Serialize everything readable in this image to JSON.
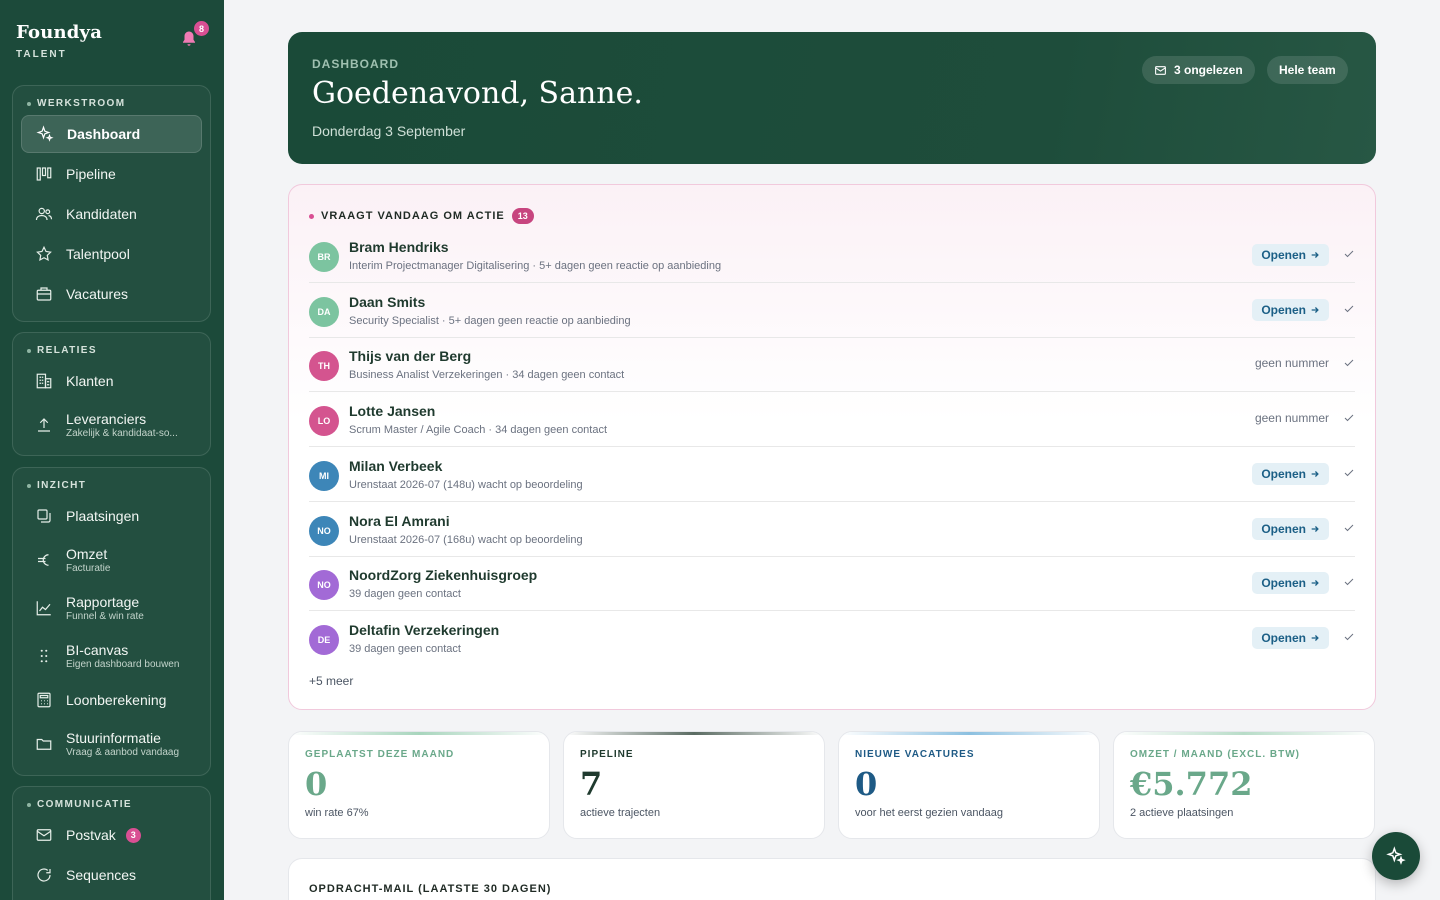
{
  "brand": {
    "name": "Foundya",
    "sub": "TALENT",
    "notifications": "8"
  },
  "nav": {
    "werkstroom": {
      "title": "WERKSTROOM",
      "items": [
        {
          "label": "Dashboard",
          "icon": "sparkle-icon"
        },
        {
          "label": "Pipeline",
          "icon": "kanban-icon"
        },
        {
          "label": "Kandidaten",
          "icon": "users-icon"
        },
        {
          "label": "Talentpool",
          "icon": "star-icon"
        },
        {
          "label": "Vacatures",
          "icon": "briefcase-icon"
        }
      ]
    },
    "relaties": {
      "title": "RELATIES",
      "items": [
        {
          "label": "Klanten",
          "icon": "building-icon"
        },
        {
          "label": "Leveranciers",
          "sub": "Zakelijk & kandidaat-so...",
          "icon": "upload-icon"
        }
      ]
    },
    "inzicht": {
      "title": "INZICHT",
      "items": [
        {
          "label": "Plaatsingen",
          "icon": "copy-icon"
        },
        {
          "label": "Omzet",
          "sub": "Facturatie",
          "icon": "euro-icon"
        },
        {
          "label": "Rapportage",
          "sub": "Funnel & win rate",
          "icon": "chart-icon"
        },
        {
          "label": "BI-canvas",
          "sub": "Eigen dashboard bouwen",
          "icon": "grid-dots-icon"
        },
        {
          "label": "Loonberekening",
          "icon": "calculator-icon"
        },
        {
          "label": "Stuurinformatie",
          "sub": "Vraag & aanbod vandaag",
          "icon": "folder-icon"
        }
      ]
    },
    "communicatie": {
      "title": "COMMUNICATIE",
      "items": [
        {
          "label": "Postvak",
          "badge": "3",
          "icon": "mail-icon"
        },
        {
          "label": "Sequences",
          "icon": "refresh-icon"
        }
      ]
    }
  },
  "header": {
    "eyebrow": "DASHBOARD",
    "title": "Goedenavond, Sanne.",
    "date": "Donderdag 3 September",
    "unread": "3 ongelezen",
    "team": "Hele team"
  },
  "action": {
    "title": "VRAAGT VANDAAG OM ACTIE",
    "count": "13",
    "open_label": "Openen",
    "no_number_label": "geen nummer",
    "more": "+5 meer",
    "rows": [
      {
        "initials": "BR",
        "name": "Bram Hendriks",
        "sub": "Interim Projectmanager Digitalisering · 5+ dagen geen reactie op aanbieding",
        "action": "open",
        "color": "#7cc4a0"
      },
      {
        "initials": "DA",
        "name": "Daan Smits",
        "sub": "Security Specialist · 5+ dagen geen reactie op aanbieding",
        "action": "open",
        "color": "#7cc4a0"
      },
      {
        "initials": "TH",
        "name": "Thijs van der Berg",
        "sub": "Business Analist Verzekeringen · 34 dagen geen contact",
        "action": "none",
        "color": "#d4548f"
      },
      {
        "initials": "LO",
        "name": "Lotte Jansen",
        "sub": "Scrum Master / Agile Coach · 34 dagen geen contact",
        "action": "none",
        "color": "#d4548f"
      },
      {
        "initials": "MI",
        "name": "Milan Verbeek",
        "sub": "Urenstaat 2026-07 (148u) wacht op beoordeling",
        "action": "open",
        "color": "#3d86b8"
      },
      {
        "initials": "NO",
        "name": "Nora El Amrani",
        "sub": "Urenstaat 2026-07 (168u) wacht op beoordeling",
        "action": "open",
        "color": "#3d86b8"
      },
      {
        "initials": "NO",
        "name": "NoordZorg Ziekenhuisgroep",
        "sub": "39 dagen geen contact",
        "action": "open",
        "color": "#a26ad6"
      },
      {
        "initials": "DE",
        "name": "Deltafin Verzekeringen",
        "sub": "39 dagen geen contact",
        "action": "open",
        "color": "#a26ad6"
      }
    ]
  },
  "kpis": [
    {
      "label": "GEPLAATST DEZE MAAND",
      "value": "0",
      "sub": "win rate 67%",
      "color": "#6aa88a"
    },
    {
      "label": "PIPELINE",
      "value": "7",
      "sub": "actieve trajecten",
      "color": "#1f3a2e"
    },
    {
      "label": "NIEUWE VACATURES",
      "value": "0",
      "sub": "voor het eerst gezien vandaag",
      "color": "#1e5a85"
    },
    {
      "label": "OMZET / MAAND (EXCL. BTW)",
      "value": "€5.772",
      "sub": "2 actieve plaatsingen",
      "color": "#6aa88a"
    }
  ],
  "bottom": {
    "title": "OPDRACHT-MAIL (LAATSTE 30 DAGEN)"
  }
}
